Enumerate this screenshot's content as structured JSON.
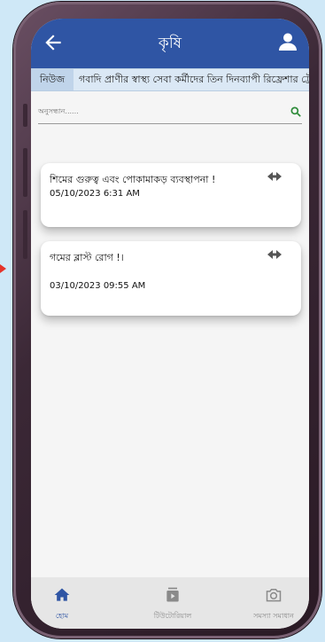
{
  "header": {
    "title": "কৃষি"
  },
  "news": {
    "badge": "নিউজ",
    "ticker": "গবাদি প্রাণীর স্বাস্থ্য সেবা কর্মীদের তিন দিনব্যাপী রিফ্রেশার ট্রেনিং"
  },
  "search": {
    "placeholder": "অনুসন্ধান......"
  },
  "posts": [
    {
      "title": "শিমের গুরুত্ব এবং পোকামাকড় ব্যবস্থাপনা !",
      "date": "05/10/2023 6:31  AM"
    },
    {
      "title": "গমের ব্লাস্ট রোগ !।",
      "date": "03/10/2023 09:55  AM"
    }
  ],
  "nav": {
    "home": "হোম",
    "tutorial": "টিউটোরিয়াল",
    "solution": "সমস্যা সমাধান"
  },
  "colors": {
    "primary": "#2f55a4",
    "accent_search": "#2e8b3a"
  },
  "icons": [
    "back-arrow-icon",
    "user-icon",
    "search-icon",
    "share-icon",
    "home-icon",
    "tutorial-icon",
    "camera-icon"
  ]
}
